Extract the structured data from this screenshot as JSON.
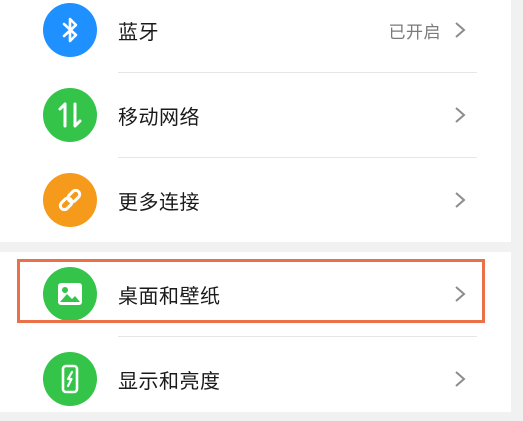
{
  "settings": {
    "items": [
      {
        "label": "蓝牙",
        "status": "已开启",
        "icon": "bluetooth-icon",
        "icon_color": "#1e90ff"
      },
      {
        "label": "移动网络",
        "status": "",
        "icon": "mobile-data-icon",
        "icon_color": "#34c44a"
      },
      {
        "label": "更多连接",
        "status": "",
        "icon": "link-icon",
        "icon_color": "#f59a1b"
      },
      {
        "label": "桌面和壁纸",
        "status": "",
        "icon": "wallpaper-icon",
        "icon_color": "#34c44a"
      },
      {
        "label": "显示和亮度",
        "status": "",
        "icon": "display-brightness-icon",
        "icon_color": "#34c44a"
      }
    ],
    "highlighted_item": "桌面和壁纸",
    "highlight_color": "#ea7047"
  }
}
